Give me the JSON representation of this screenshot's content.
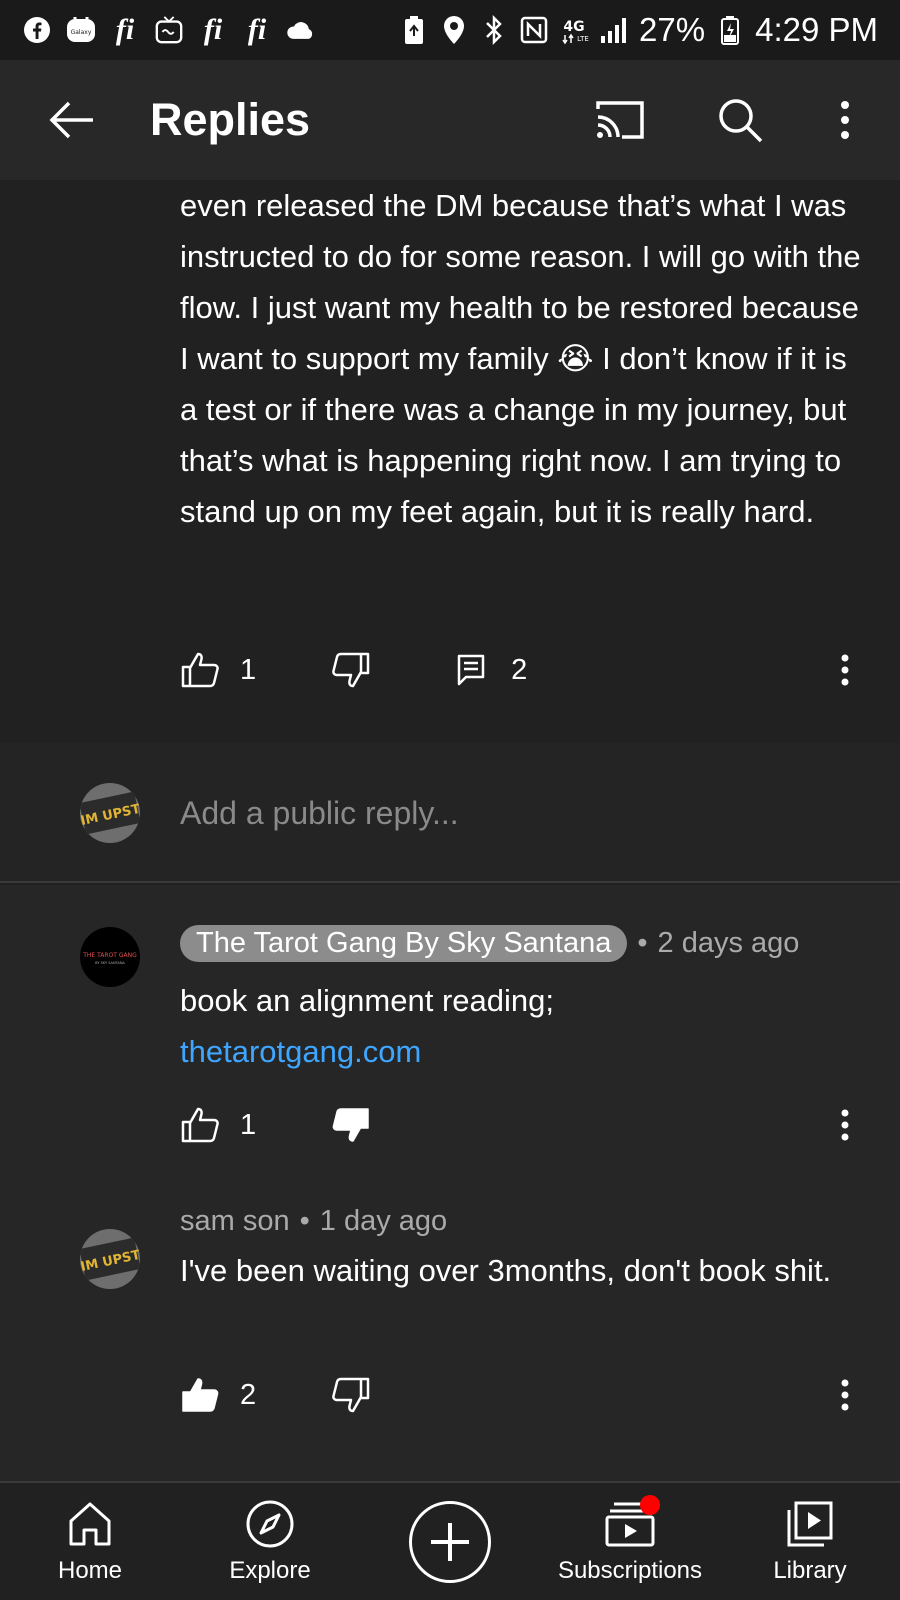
{
  "status_bar": {
    "battery": "27%",
    "time": "4:29 PM",
    "network": "4G LTE",
    "left_icons": [
      "facebook-icon",
      "galaxy-wearable-icon",
      "fi-icon",
      "tv-icon",
      "fi-icon",
      "fi-icon",
      "cloud-icon"
    ],
    "right_icons": [
      "battery-saver-icon",
      "location-icon",
      "bluetooth-icon",
      "nfc-icon",
      "signal-icon",
      "battery-icon"
    ]
  },
  "app_bar": {
    "title": "Replies",
    "icons": [
      "back-arrow-icon",
      "cast-icon",
      "search-icon",
      "more-vert-icon"
    ]
  },
  "top_comment": {
    "text": "even released the DM because that’s what I was instructed to do for some reason. I will go with the flow. I just want my health to be restored because I want to support my family 😭 I don’t know if it is a test or if there was a change in my journey, but that’s what is happening right now. I am trying to stand up on my feet again, but it is really hard.",
    "likes": "1",
    "replies": "2"
  },
  "reply_input": {
    "placeholder": "Add a public reply...",
    "avatar_text": "IM UPST"
  },
  "replies": [
    {
      "author": "The Tarot Gang By Sky Santana",
      "time": "2 days ago",
      "text": "book an alignment reading;",
      "link": "thetarotgang.com",
      "likes": "1",
      "avatar_text": "THE TAROT GANG"
    },
    {
      "author": "sam son",
      "time": "1 day ago",
      "text": "I've been waiting over 3months, don't book shit.",
      "likes": "2",
      "avatar_text": "IM UPST"
    }
  ],
  "bottom_nav": {
    "items": [
      {
        "label": "Home",
        "icon": "home-icon"
      },
      {
        "label": "Explore",
        "icon": "compass-icon"
      },
      {
        "label": "",
        "icon": "create-icon"
      },
      {
        "label": "Subscriptions",
        "icon": "subscriptions-icon"
      },
      {
        "label": "Library",
        "icon": "library-icon"
      }
    ]
  },
  "colors": {
    "background": "#212121",
    "link": "#3ea6ff",
    "notification": "#ff0000",
    "chip": "#8c8c8c"
  }
}
